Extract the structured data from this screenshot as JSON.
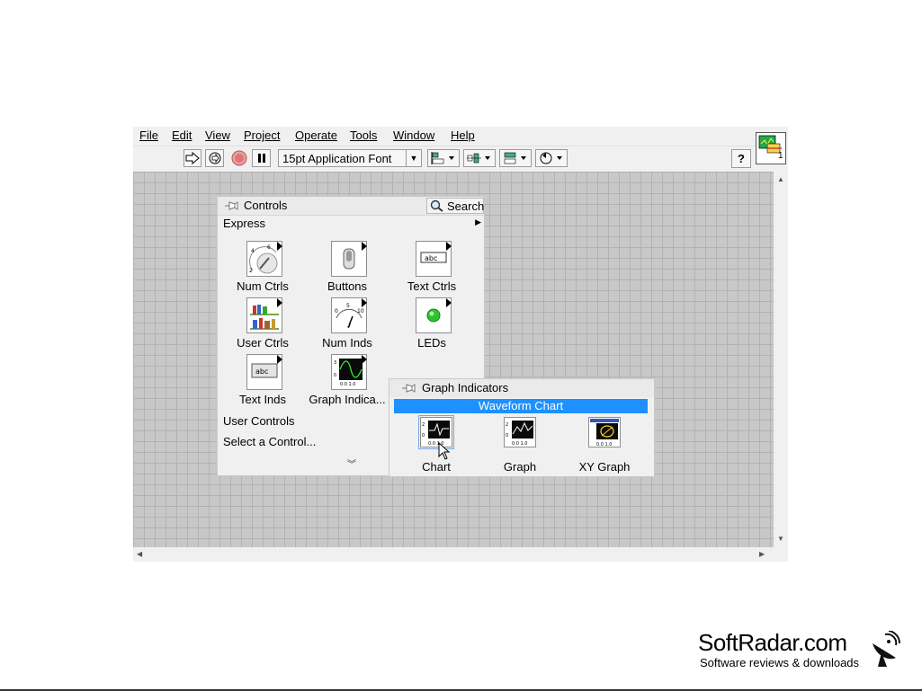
{
  "menu": {
    "items": [
      "File",
      "Edit",
      "View",
      "Project",
      "Operate",
      "Tools",
      "Window",
      "Help"
    ]
  },
  "toolbar": {
    "font": "15pt Application Font",
    "icons": [
      "run-arrow-icon",
      "run-continuously-icon",
      "abort-icon",
      "pause-icon",
      "align-objects-icon",
      "distribute-objects-icon",
      "resize-objects-icon",
      "reorder-icon",
      "help-icon"
    ]
  },
  "vi_icon": {
    "number": "1"
  },
  "controls_palette": {
    "title": "Controls",
    "search_label": "Search",
    "category": "Express",
    "items": [
      {
        "label": "Num Ctrls",
        "icon": "knob-icon"
      },
      {
        "label": "Buttons",
        "icon": "toggle-switch-icon"
      },
      {
        "label": "Text Ctrls",
        "icon": "text-box-icon"
      },
      {
        "label": "User Ctrls",
        "icon": "bookshelf-icon"
      },
      {
        "label": "Num Inds",
        "icon": "meter-icon"
      },
      {
        "label": "LEDs",
        "icon": "green-led-icon"
      },
      {
        "label": "Text Inds",
        "icon": "text-indicator-icon"
      },
      {
        "label": "Graph Indica...",
        "icon": "graph-icon"
      }
    ],
    "links": [
      "User Controls",
      "Select a Control..."
    ]
  },
  "graph_palette": {
    "title": "Graph Indicators",
    "tooltip": "Waveform Chart",
    "items": [
      {
        "label": "Chart",
        "icon": "waveform-chart-icon"
      },
      {
        "label": "Graph",
        "icon": "waveform-graph-icon"
      },
      {
        "label": "XY Graph",
        "icon": "xy-graph-icon"
      }
    ]
  },
  "watermark": {
    "name": "SoftRadar.com",
    "tagline": "Software reviews & downloads"
  }
}
